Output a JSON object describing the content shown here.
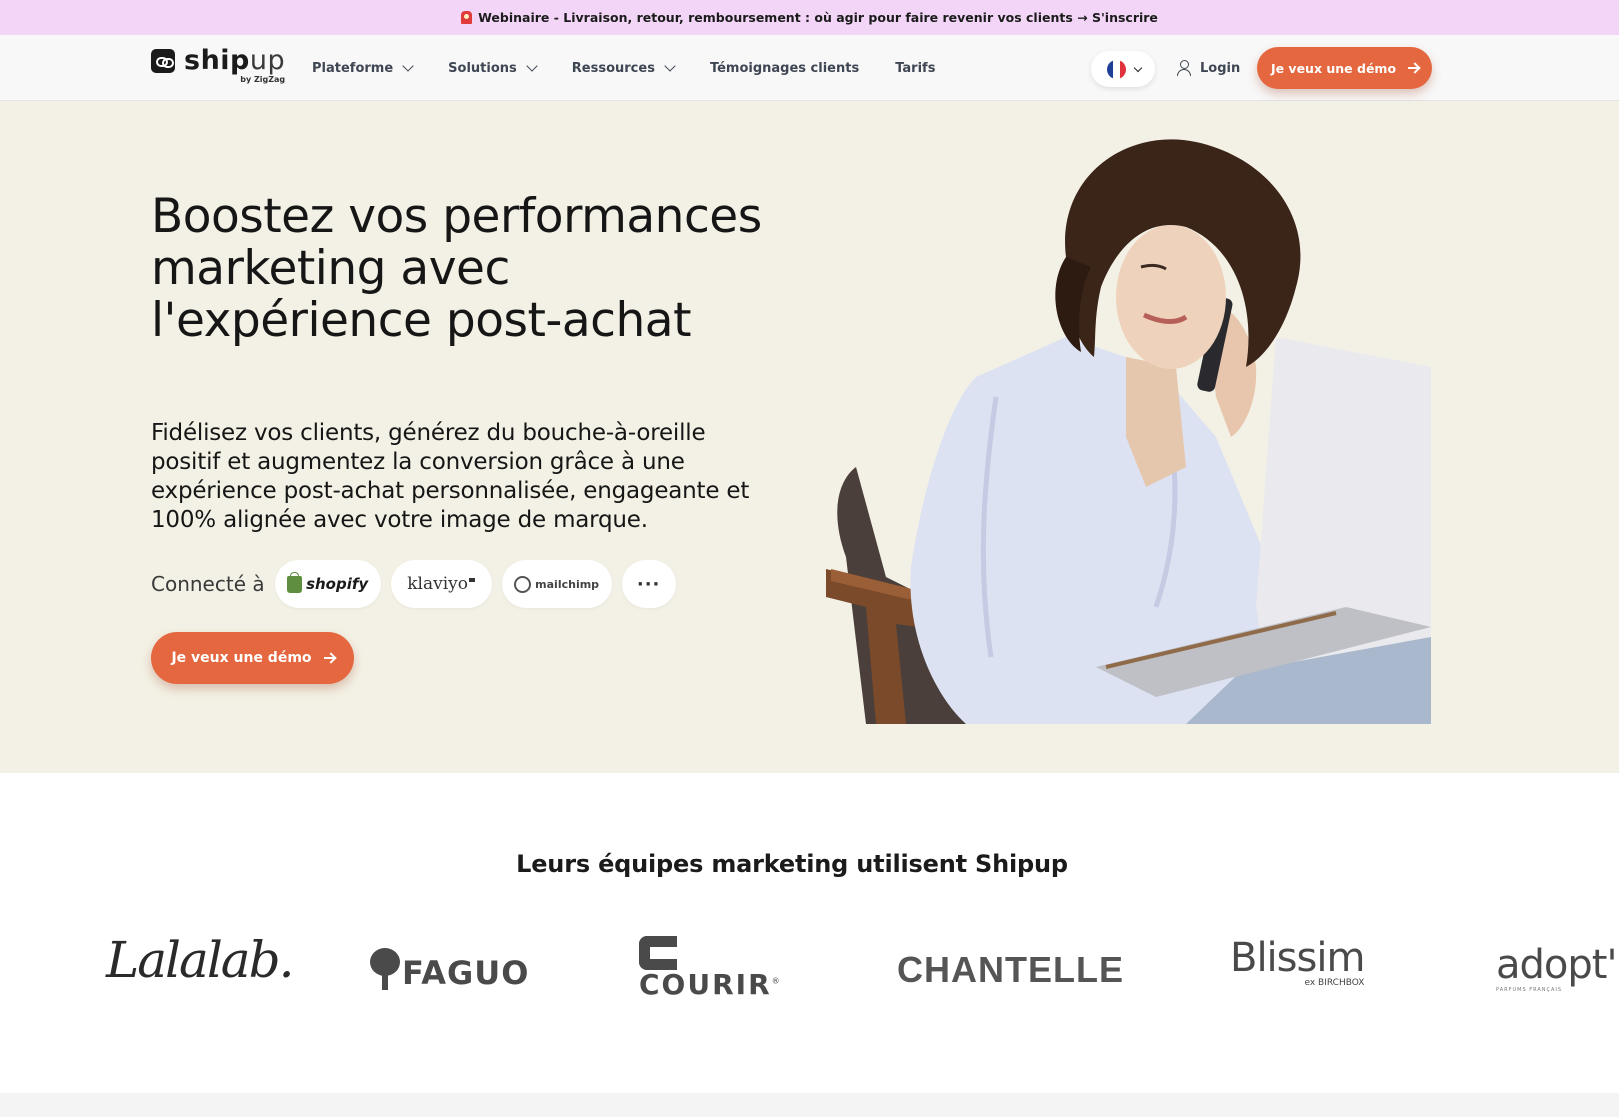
{
  "banner": {
    "text": "Webinaire - Livraison, retour, remboursement : où agir pour faire revenir vos clients → S'inscrire"
  },
  "nav": {
    "logo_word_bold": "ship",
    "logo_word_light": "up",
    "logo_sub": "by ZigZag",
    "items": [
      {
        "label": "Plateforme",
        "dropdown": true
      },
      {
        "label": "Solutions",
        "dropdown": true
      },
      {
        "label": "Ressources",
        "dropdown": true
      },
      {
        "label": "Témoignages clients",
        "dropdown": false
      },
      {
        "label": "Tarifs",
        "dropdown": false
      }
    ],
    "language_flag": "france-flag-icon",
    "login_label": "Login",
    "cta_label": "Je veux une démo"
  },
  "hero": {
    "title": "Boostez vos performances marketing avec l'expérience post-achat",
    "subtitle": "Fidélisez vos clients, générez du bouche-à-oreille positif et augmentez la conversion grâce à une expérience post-achat personnalisée, engageante et 100% alignée avec votre image de marque.",
    "connect_label": "Connecté à",
    "integrations": [
      "shopify",
      "klaviyo",
      "mailchimp"
    ],
    "more_label": "···",
    "cta_label": "Je veux une démo"
  },
  "clients": {
    "title": "Leurs équipes marketing utilisent Shipup",
    "brands": {
      "lalalab": "Lalalab.",
      "faguo": "FAGUO",
      "courir": "COURIR",
      "chantelle": "CHANTELLE",
      "blissim": "Blissim",
      "blissim_sub": "ex BIRCHBOX",
      "adopt": "adopt'",
      "adopt_sub": "PARFUMS FRANÇAIS"
    }
  },
  "colors": {
    "banner_bg": "#f3d6f7",
    "hero_bg": "#f3f1e5",
    "accent": "#e4673f",
    "nav_text": "#3f4653"
  }
}
